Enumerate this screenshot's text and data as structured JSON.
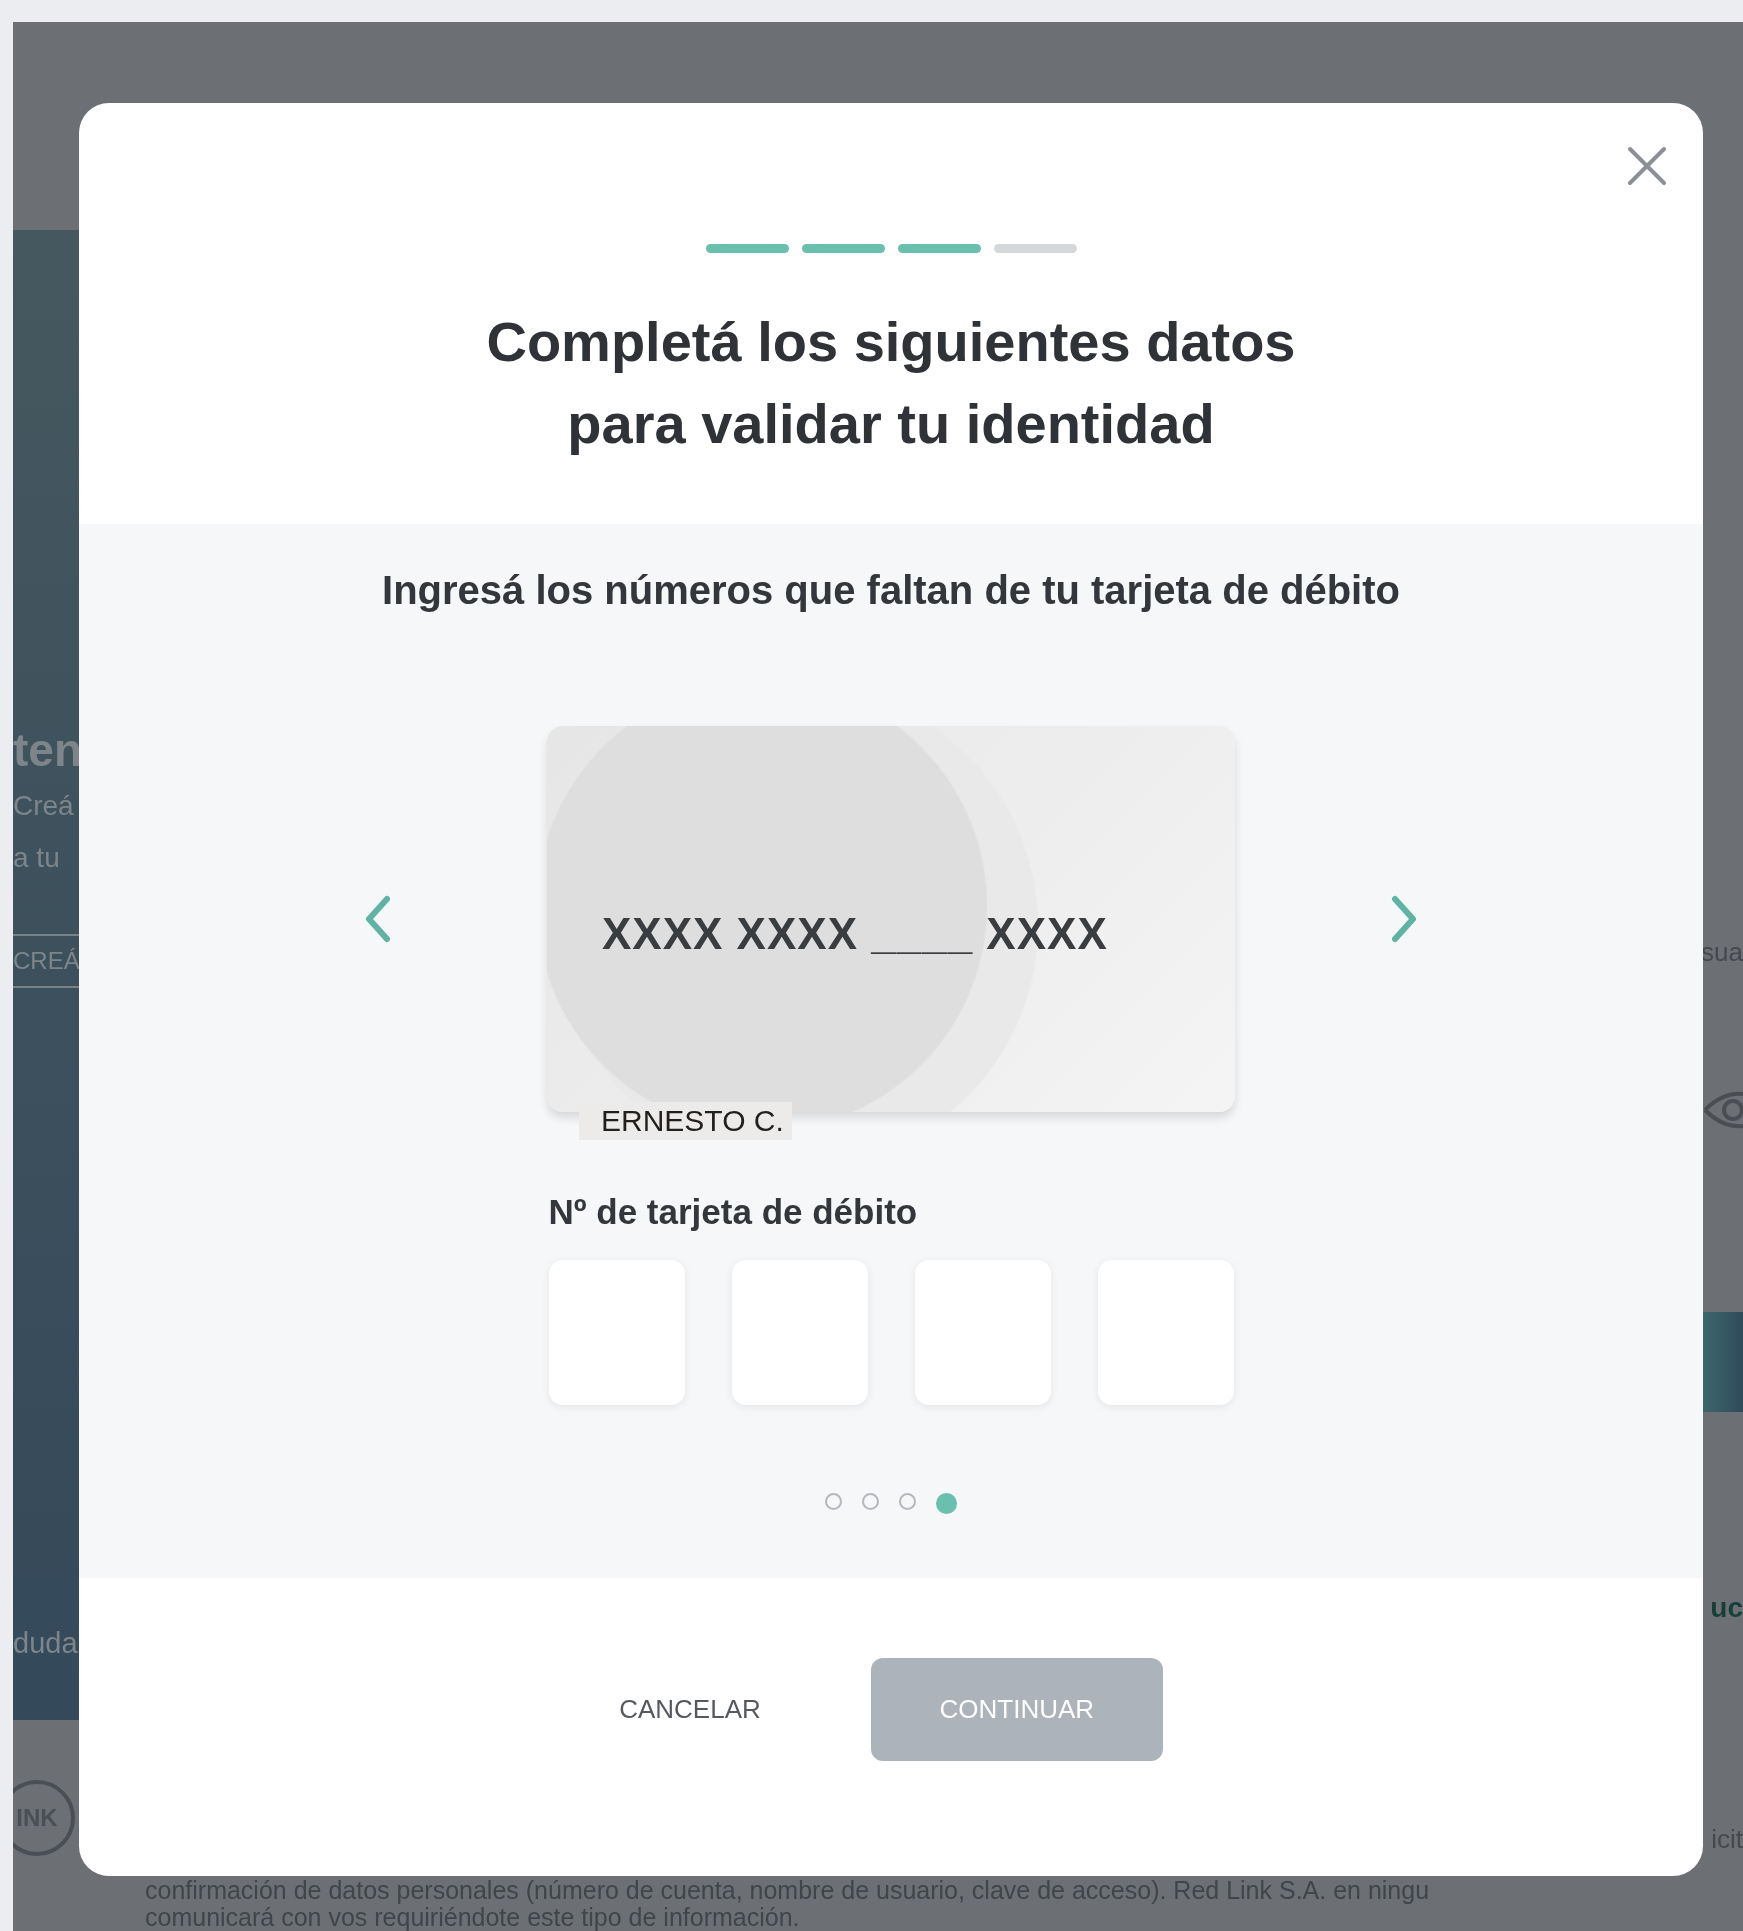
{
  "background": {
    "left_texts": [
      {
        "kind": "heading",
        "text": "ten"
      },
      {
        "kind": "text",
        "text": "Creá"
      },
      {
        "kind": "text",
        "text": "a tu"
      },
      {
        "kind": "tab",
        "text": "CREÁ"
      },
      {
        "kind": "link",
        "text": "duda"
      }
    ],
    "right_texts": [
      {
        "kind": "text",
        "text": "sua"
      },
      {
        "kind": "eye"
      },
      {
        "kind": "button"
      },
      {
        "kind": "link",
        "text": "uc"
      },
      {
        "kind": "text",
        "text": "icit"
      }
    ],
    "logo_text": "INK",
    "footer_lines": [
      "confirmación de datos personales (número de cuenta, nombre de usuario, clave de acceso). Red Link S.A. en ningu",
      "comunicará con vos requiriéndote este tipo de información."
    ]
  },
  "modal": {
    "steps": [
      {
        "done": true
      },
      {
        "done": true
      },
      {
        "done": true
      },
      {
        "done": false
      }
    ],
    "title": [
      "Completá los siguientes datos",
      "para validar tu identidad"
    ],
    "subtitle": "Ingresá los números que faltan de tu tarjeta de débito",
    "card": {
      "number": "XXXX XXXX ____ XXXX",
      "holder": "ERNESTO C."
    },
    "field_label": "Nº de tarjeta de débito",
    "pages": [
      {
        "selected": false
      },
      {
        "selected": false
      },
      {
        "selected": false
      },
      {
        "selected": true
      }
    ],
    "cancel_button": "CANCELAR",
    "continue_button": {
      "label": "CONTINUAR",
      "disabled": true
    }
  }
}
